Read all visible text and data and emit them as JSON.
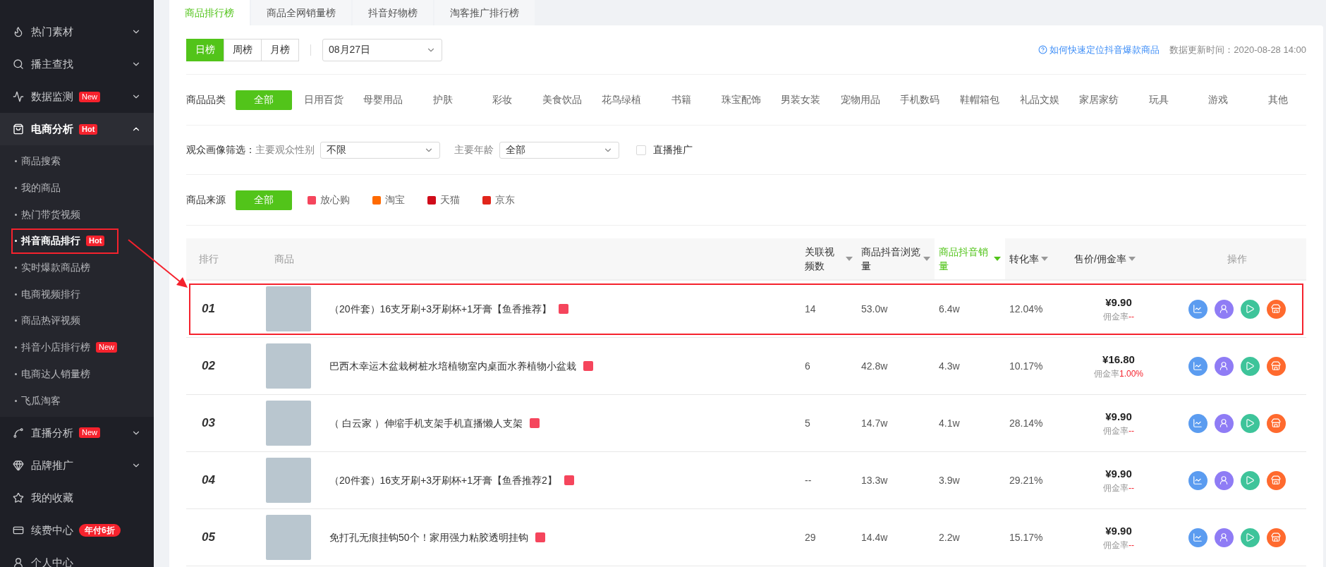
{
  "sidebar": {
    "items": [
      {
        "label": "热门素材",
        "kind": "group",
        "expanded": false
      },
      {
        "label": "播主查找",
        "kind": "group",
        "expanded": false
      },
      {
        "label": "数据监测",
        "kind": "group",
        "expanded": false,
        "badge": "New"
      },
      {
        "label": "电商分析",
        "kind": "group",
        "expanded": true,
        "badge": "Hot",
        "children": [
          {
            "label": "商品搜索",
            "selected": false,
            "highlighted": false
          },
          {
            "label": "我的商品",
            "selected": false,
            "highlighted": false
          },
          {
            "label": "热门带货视频",
            "selected": false,
            "highlighted": false
          },
          {
            "label": "抖音商品排行",
            "selected": true,
            "highlighted": true,
            "badge": "Hot"
          },
          {
            "label": "实时爆款商品榜",
            "selected": false,
            "highlighted": false
          },
          {
            "label": "电商视频排行",
            "selected": false,
            "highlighted": false
          },
          {
            "label": "商品热评视频",
            "selected": false,
            "highlighted": false
          },
          {
            "label": "抖音小店排行榜",
            "selected": false,
            "highlighted": false,
            "badge": "New"
          },
          {
            "label": "电商达人销量榜",
            "selected": false,
            "highlighted": false
          },
          {
            "label": "飞瓜淘客",
            "selected": false,
            "highlighted": false
          }
        ]
      },
      {
        "label": "直播分析",
        "kind": "group",
        "expanded": false,
        "badge": "New"
      },
      {
        "label": "品牌推广",
        "kind": "group",
        "expanded": false
      },
      {
        "label": "我的收藏",
        "kind": "link"
      },
      {
        "label": "续费中心",
        "kind": "link",
        "badge": "年付6折"
      },
      {
        "label": "个人中心",
        "kind": "link"
      }
    ]
  },
  "tabs": [
    {
      "label": "商品排行榜",
      "selected": true
    },
    {
      "label": "商品全网销量榜",
      "selected": false
    },
    {
      "label": "抖音好物榜",
      "selected": false
    },
    {
      "label": "淘客推广排行榜",
      "selected": false
    }
  ],
  "period": [
    {
      "label": "日榜",
      "selected": true
    },
    {
      "label": "周榜",
      "selected": false
    },
    {
      "label": "月榜",
      "selected": false
    }
  ],
  "date_select": {
    "value": "08月27日"
  },
  "help_link": "如何快速定位抖音爆款商品",
  "update_time": "数据更新时间：2020-08-28 14:00",
  "category": {
    "label": "商品品类",
    "options": [
      {
        "label": "全部",
        "selected": true
      },
      {
        "label": "日用百货",
        "selected": false
      },
      {
        "label": "母婴用品",
        "selected": false
      },
      {
        "label": "护肤",
        "selected": false
      },
      {
        "label": "彩妆",
        "selected": false
      },
      {
        "label": "美食饮品",
        "selected": false
      },
      {
        "label": "花鸟绿植",
        "selected": false
      },
      {
        "label": "书籍",
        "selected": false
      },
      {
        "label": "珠宝配饰",
        "selected": false
      },
      {
        "label": "男装女装",
        "selected": false
      },
      {
        "label": "宠物用品",
        "selected": false
      },
      {
        "label": "手机数码",
        "selected": false
      },
      {
        "label": "鞋帽箱包",
        "selected": false
      },
      {
        "label": "礼品文娱",
        "selected": false
      },
      {
        "label": "家居家纺",
        "selected": false
      },
      {
        "label": "玩具",
        "selected": false
      },
      {
        "label": "游戏",
        "selected": false
      },
      {
        "label": "其他",
        "selected": false
      }
    ]
  },
  "audience": {
    "label": "观众画像筛选：",
    "gender_label": "主要观众性别",
    "gender_value": "不限",
    "age_label": "主要年龄",
    "age_value": "全部",
    "live_promo": {
      "label": "直播推广",
      "checked": false
    }
  },
  "source": {
    "label": "商品来源",
    "options": [
      {
        "label": "全部",
        "selected": true,
        "kind": "all"
      },
      {
        "label": "放心购",
        "selected": false,
        "kind": "bag"
      },
      {
        "label": "淘宝",
        "selected": false,
        "kind": "taobao"
      },
      {
        "label": "天猫",
        "selected": false,
        "kind": "tmall"
      },
      {
        "label": "京东",
        "selected": false,
        "kind": "jd"
      }
    ]
  },
  "table": {
    "columns": [
      {
        "label": "排行",
        "kind": "plain"
      },
      {
        "label": "商品",
        "kind": "plain"
      },
      {
        "label": "关联视频数",
        "kind": "sortable",
        "selected": false
      },
      {
        "label": "商品抖音浏览量",
        "kind": "sortable",
        "selected": false
      },
      {
        "label": "商品抖音销量",
        "kind": "sortable",
        "selected": true
      },
      {
        "label": "转化率",
        "kind": "sortable",
        "selected": false
      },
      {
        "label": "售价/佣金率",
        "kind": "sortable",
        "selected": false
      },
      {
        "label": "操作",
        "kind": "plain"
      }
    ],
    "rows": [
      {
        "rank": "01",
        "name": "（20件套）16支牙刷+3牙刷杯+1牙膏【鱼香推荐】",
        "videos": "14",
        "views": "53.0w",
        "sales": "6.4w",
        "conversion": "12.04%",
        "price": "¥9.90",
        "commission_label": "佣金率",
        "commission": "--",
        "highlighted": true
      },
      {
        "rank": "02",
        "name": "巴西木幸运木盆栽树桩水培植物室内桌面水养植物小盆栽",
        "videos": "6",
        "views": "42.8w",
        "sales": "4.3w",
        "conversion": "10.17%",
        "price": "¥16.80",
        "commission_label": "佣金率",
        "commission": "1.00%",
        "highlighted": false
      },
      {
        "rank": "03",
        "name": "（ 白云家 ）伸缩手机支架手机直播懒人支架",
        "videos": "5",
        "views": "14.7w",
        "sales": "4.1w",
        "conversion": "28.14%",
        "price": "¥9.90",
        "commission_label": "佣金率",
        "commission": "--",
        "highlighted": false
      },
      {
        "rank": "04",
        "name": "（20件套）16支牙刷+3牙刷杯+1牙膏【鱼香推荐2】",
        "videos": "--",
        "views": "13.3w",
        "sales": "3.9w",
        "conversion": "29.21%",
        "price": "¥9.90",
        "commission_label": "佣金率",
        "commission": "--",
        "highlighted": false
      },
      {
        "rank": "05",
        "name": "免打孔无痕挂钩50个！家用强力粘胶透明挂钩",
        "videos": "29",
        "views": "14.4w",
        "sales": "2.2w",
        "conversion": "15.17%",
        "price": "¥9.90",
        "commission_label": "佣金率",
        "commission": "--",
        "highlighted": false
      }
    ]
  }
}
